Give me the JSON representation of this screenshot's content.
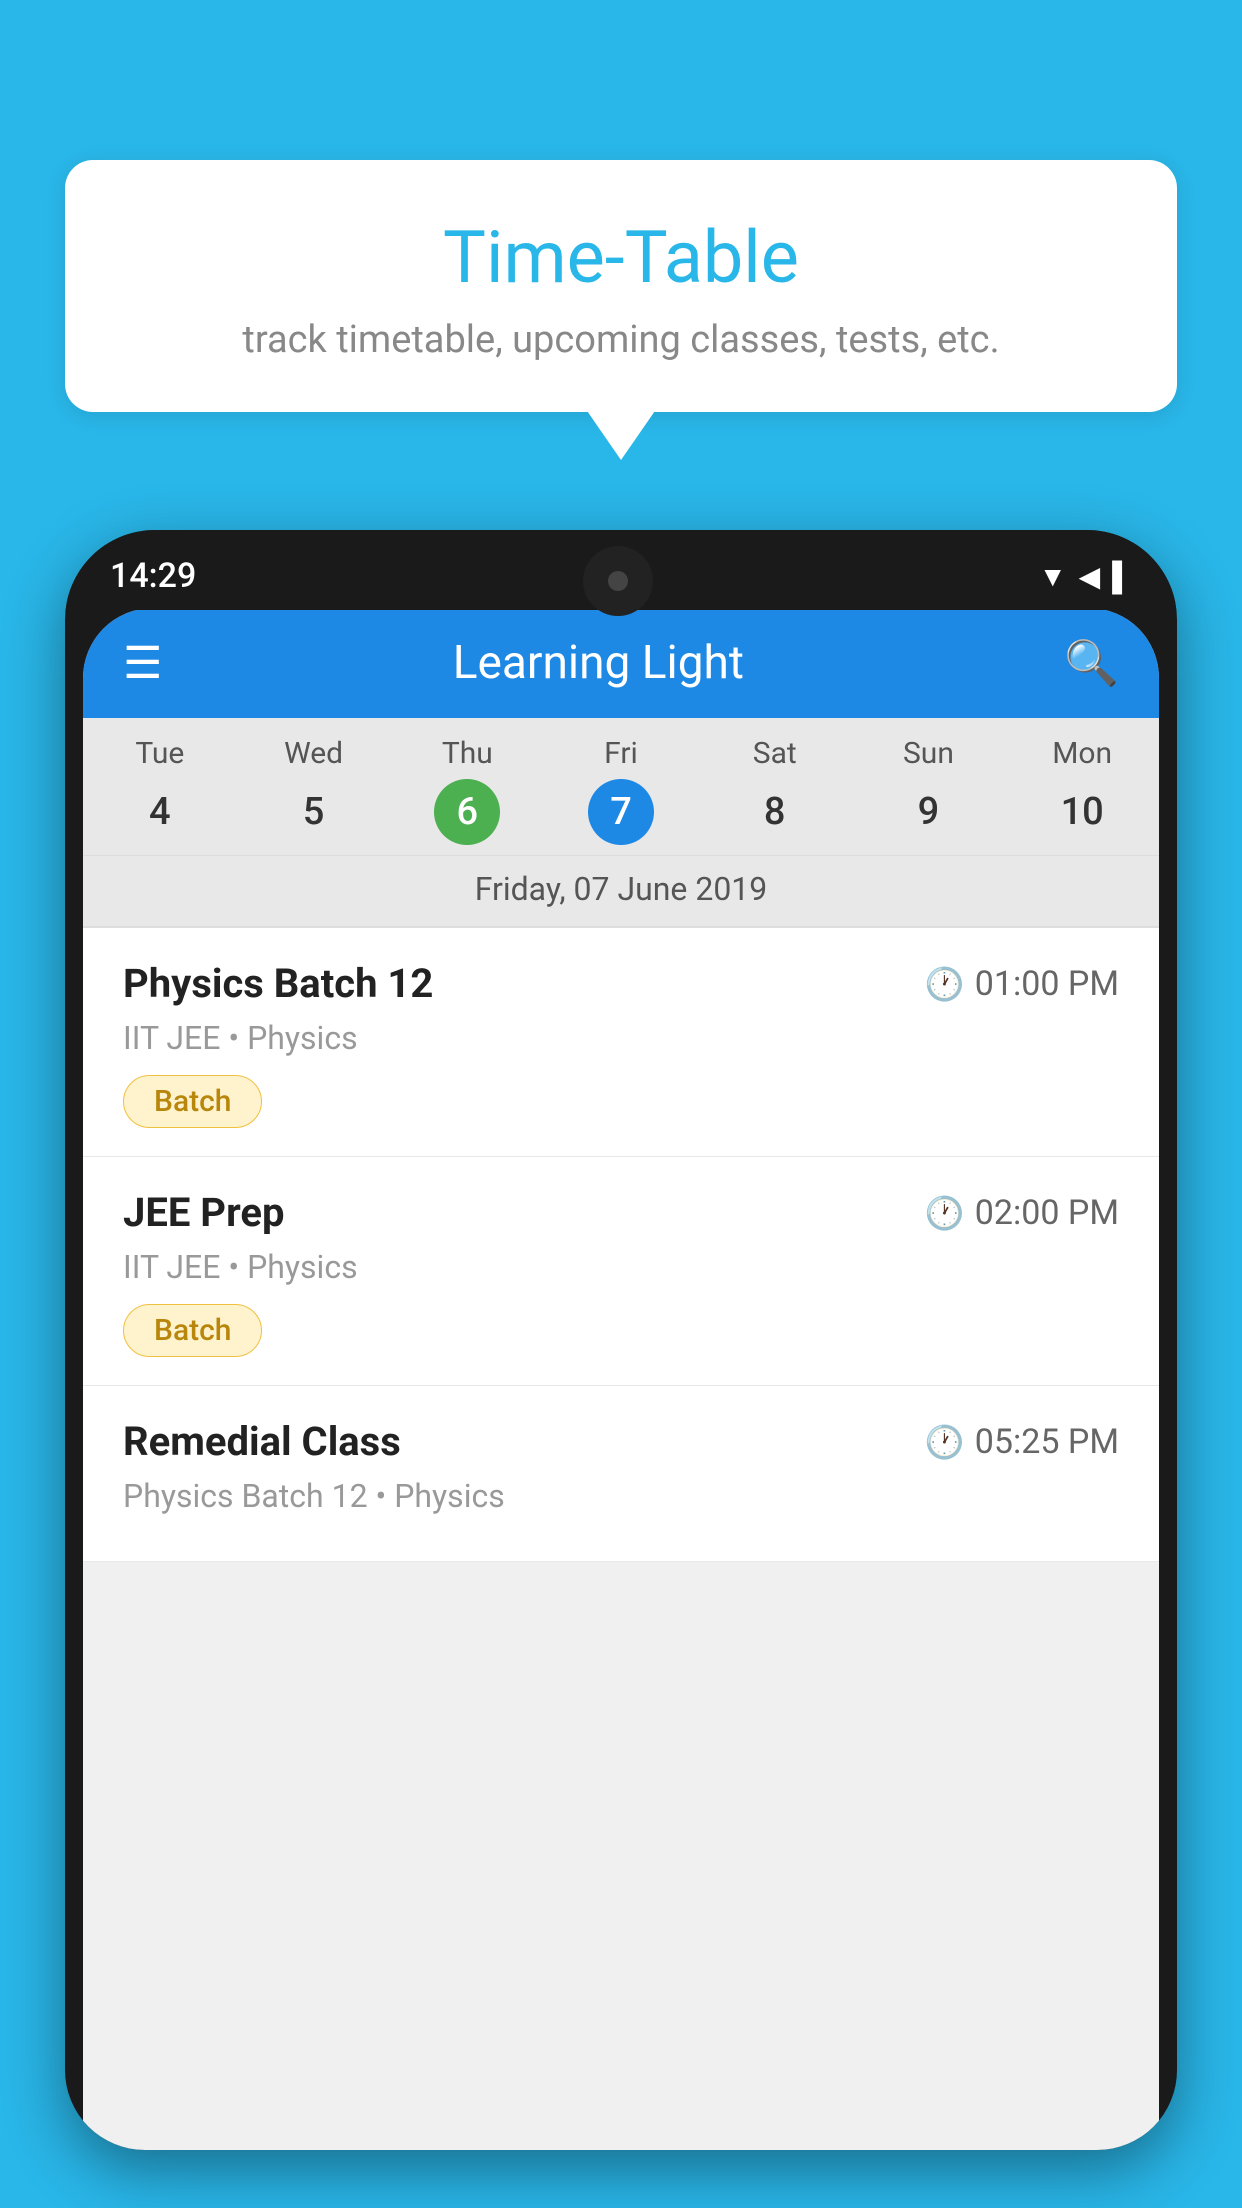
{
  "background": {
    "color": "#29b6e8"
  },
  "tooltip": {
    "title": "Time-Table",
    "subtitle": "track timetable, upcoming classes, tests, etc."
  },
  "phone": {
    "status_bar": {
      "time": "14:29",
      "icons": [
        "▼",
        "◀",
        "▌"
      ]
    },
    "app_bar": {
      "menu_icon": "☰",
      "title": "Learning Light",
      "search_icon": "🔍"
    },
    "calendar": {
      "days": [
        {
          "name": "Tue",
          "num": "4",
          "state": "normal"
        },
        {
          "name": "Wed",
          "num": "5",
          "state": "normal"
        },
        {
          "name": "Thu",
          "num": "6",
          "state": "today"
        },
        {
          "name": "Fri",
          "num": "7",
          "state": "selected"
        },
        {
          "name": "Sat",
          "num": "8",
          "state": "normal"
        },
        {
          "name": "Sun",
          "num": "9",
          "state": "normal"
        },
        {
          "name": "Mon",
          "num": "10",
          "state": "normal"
        }
      ],
      "selected_date_label": "Friday, 07 June 2019"
    },
    "schedule": [
      {
        "name": "Physics Batch 12",
        "time": "01:00 PM",
        "sub": "IIT JEE • Physics",
        "badge": "Batch"
      },
      {
        "name": "JEE Prep",
        "time": "02:00 PM",
        "sub": "IIT JEE • Physics",
        "badge": "Batch"
      },
      {
        "name": "Remedial Class",
        "time": "05:25 PM",
        "sub": "Physics Batch 12 • Physics",
        "badge": null
      }
    ]
  }
}
